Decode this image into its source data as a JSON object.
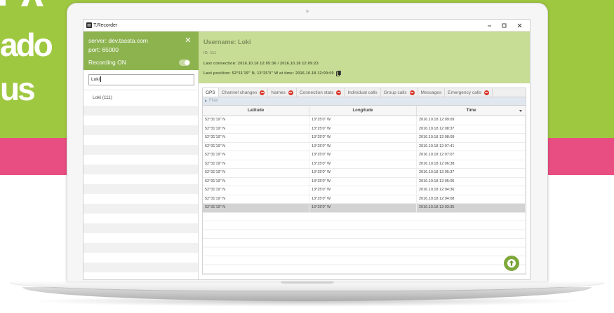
{
  "colors": {
    "background_green": "#9fc841",
    "band_pink": "#e94e82",
    "server_header": "#8db34f",
    "user_header": "#c7dc95",
    "action_button": "#7fa83b",
    "badge_red": "#d83a2e",
    "selected_row": "#d3d3d3"
  },
  "headline": {
    "line1": "ado",
    "line2": "us"
  },
  "window": {
    "title": "T.Recorder",
    "icons": {
      "app": "app-icon",
      "minimize": "minimize-icon",
      "maximize": "maximize-icon",
      "close": "close-icon"
    }
  },
  "server_panel": {
    "server": "server: dev.tassta.com",
    "port": "port: 65000",
    "recording_label": "Recording ON",
    "recording_enabled": true,
    "close_icon": "close-icon"
  },
  "search": {
    "value": "Loki"
  },
  "users": [
    {
      "label": "Loki (111)"
    }
  ],
  "user_details": {
    "username": "Username: Loki",
    "id": "ID: 111",
    "last_connection": "Last connection: 2016.10.18 12:05:36 / 2016.10.18 12:09:23",
    "last_position": "Last position: 52°31'19\" N, 13°25'0\" W at time: 2016.10.18 12:09:09",
    "copy_icon": "copy-icon"
  },
  "tabs": [
    {
      "label": "GPS",
      "active": true,
      "alert": false
    },
    {
      "label": "Channel changes",
      "active": false,
      "alert": true
    },
    {
      "label": "Names",
      "active": false,
      "alert": true
    },
    {
      "label": "Connection stats",
      "active": false,
      "alert": true
    },
    {
      "label": "Individual calls",
      "active": false,
      "alert": false
    },
    {
      "label": "Group calls",
      "active": false,
      "alert": true
    },
    {
      "label": "Messages",
      "active": false,
      "alert": false
    },
    {
      "label": "Emergency calls",
      "active": false,
      "alert": true
    }
  ],
  "filter": {
    "label": "Filter",
    "icon": "expand-arrow-icon"
  },
  "table": {
    "columns": [
      "Latitude",
      "Longitude",
      "Time"
    ],
    "rows": [
      [
        "52°31'19\" N",
        "13°25'0\" W",
        "2016.10.18 12:09:09"
      ],
      [
        "52°31'19\" N",
        "13°25'0\" W",
        "2016.10.18 12:08:37"
      ],
      [
        "52°31'19\" N",
        "13°25'0\" W",
        "2016.10.18 12:08:09"
      ],
      [
        "52°31'19\" N",
        "13°25'0\" W",
        "2016.10.18 12:07:41"
      ],
      [
        "52°31'19\" N",
        "13°25'0\" W",
        "2016.10.18 12:07:07"
      ],
      [
        "52°31'19\" N",
        "13°25'0\" W",
        "2016.10.18 12:06:38"
      ],
      [
        "52°31'19\" N",
        "13°25'0\" W",
        "2016.10.18 12:05:37"
      ],
      [
        "52°31'19\" N",
        "13°25'0\" W",
        "2016.10.18 12:05:05"
      ],
      [
        "52°31'19\" N",
        "13°25'0\" W",
        "2016.10.18 12:04:36"
      ],
      [
        "52°31'19\" N",
        "13°25'0\" W",
        "2016.10.18 12:04:08"
      ],
      [
        "52°31'19\" N",
        "13°25'0\" W",
        "2016.10.18 12:03:35"
      ]
    ],
    "selected_row_index": 10,
    "column_menu_icon": "chevron-down-icon"
  },
  "scroll_top_button": {
    "icon": "arrow-up-icon"
  }
}
